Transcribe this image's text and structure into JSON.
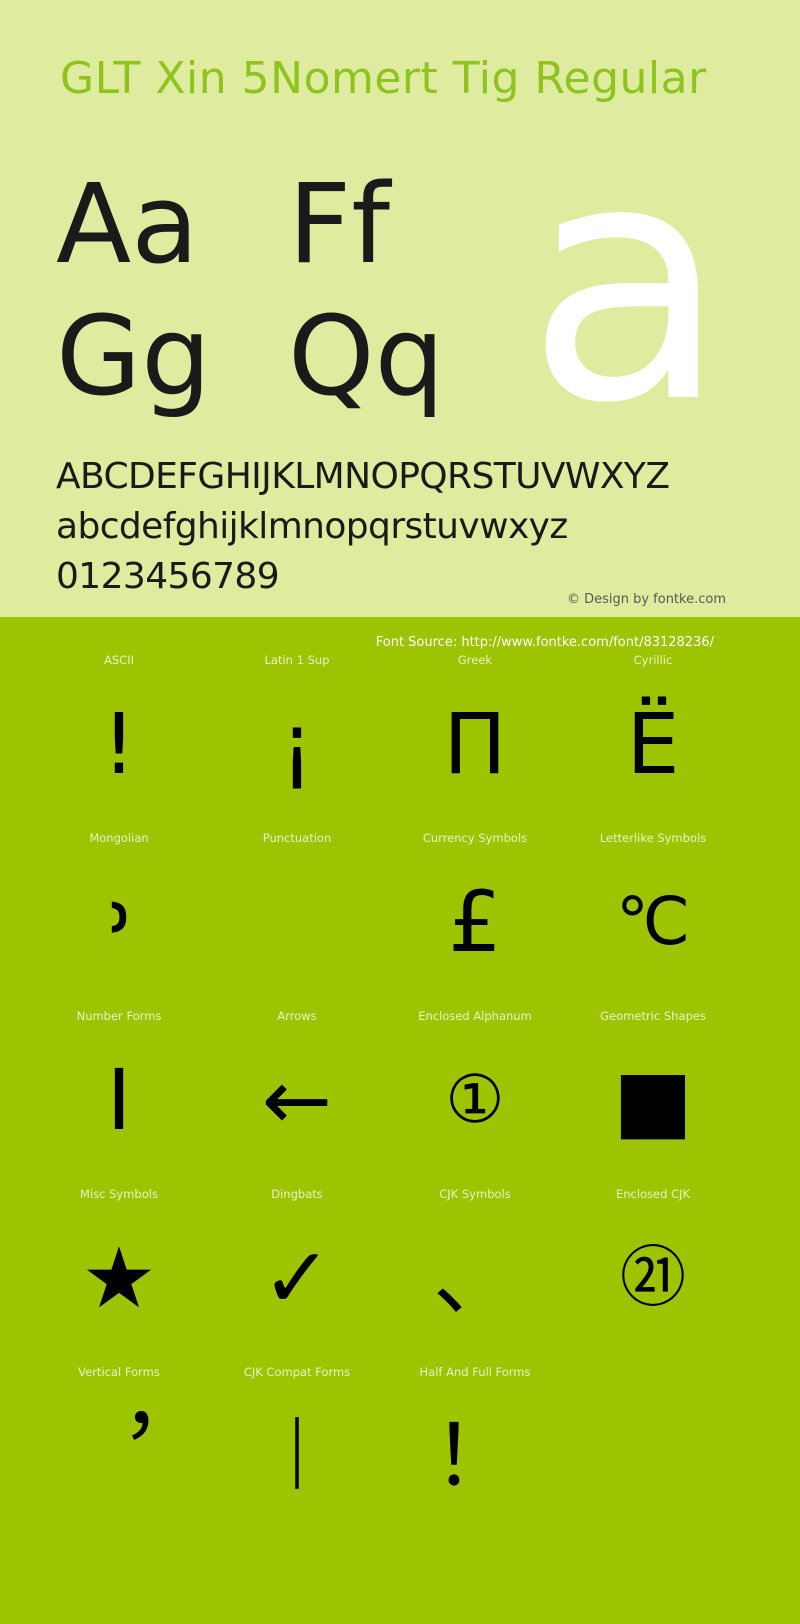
{
  "specimen": {
    "title": "GLT Xin 5Nomert Tig Regular",
    "watermark_glyph": "a",
    "sample_pairs": [
      {
        "left": "Aa",
        "right": "Ff"
      },
      {
        "left": "Gg",
        "right": "Qq"
      }
    ],
    "alphabet_lines": [
      "ABCDEFGHIJKLMNOPQRSTUVWXYZ",
      "abcdefghijklmnopqrstuvwxyz",
      "0123456789"
    ],
    "copyright": "© Design by fontke.com",
    "font_source": "Font Source: http://www.fontke.com/font/83128236/",
    "colors": {
      "top_background": "#dfeb9e",
      "bottom_background": "#9dc400",
      "title": "#8fc31f",
      "glyph": "#000000",
      "label": "#eaf3c4",
      "copyright": "#595959",
      "watermark": "#ffffff"
    }
  },
  "unicode_blocks": [
    [
      {
        "label": "ASCII",
        "glyph": "!"
      },
      {
        "label": "Latin 1 Sup",
        "glyph": "¡"
      },
      {
        "label": "Greek",
        "glyph": "Π"
      },
      {
        "label": "Cyrillic",
        "glyph": "Ё"
      }
    ],
    [
      {
        "label": "Mongolian",
        "glyph": "᠈"
      },
      {
        "label": "Punctuation",
        "glyph": " "
      },
      {
        "label": "Currency Symbols",
        "glyph": "£"
      },
      {
        "label": "Letterlike Symbols",
        "glyph": "℃"
      }
    ],
    [
      {
        "label": "Number Forms",
        "glyph": "Ⅰ"
      },
      {
        "label": "Arrows",
        "glyph": "←"
      },
      {
        "label": "Enclosed Alphanum",
        "glyph": "①"
      },
      {
        "label": "Geometric Shapes",
        "glyph": "■"
      }
    ],
    [
      {
        "label": "Misc Symbols",
        "glyph": "★"
      },
      {
        "label": "Dingbats",
        "glyph": "✓"
      },
      {
        "label": "CJK Symbols",
        "glyph": "、"
      },
      {
        "label": "Enclosed CJK",
        "glyph": "㉑"
      }
    ],
    [
      {
        "label": "Vertical Forms",
        "glyph": "︐"
      },
      {
        "label": "CJK Compat Forms",
        "glyph": "︱"
      },
      {
        "label": "Half And Full Forms",
        "glyph": "！"
      },
      {
        "label": "",
        "glyph": ""
      }
    ]
  ]
}
